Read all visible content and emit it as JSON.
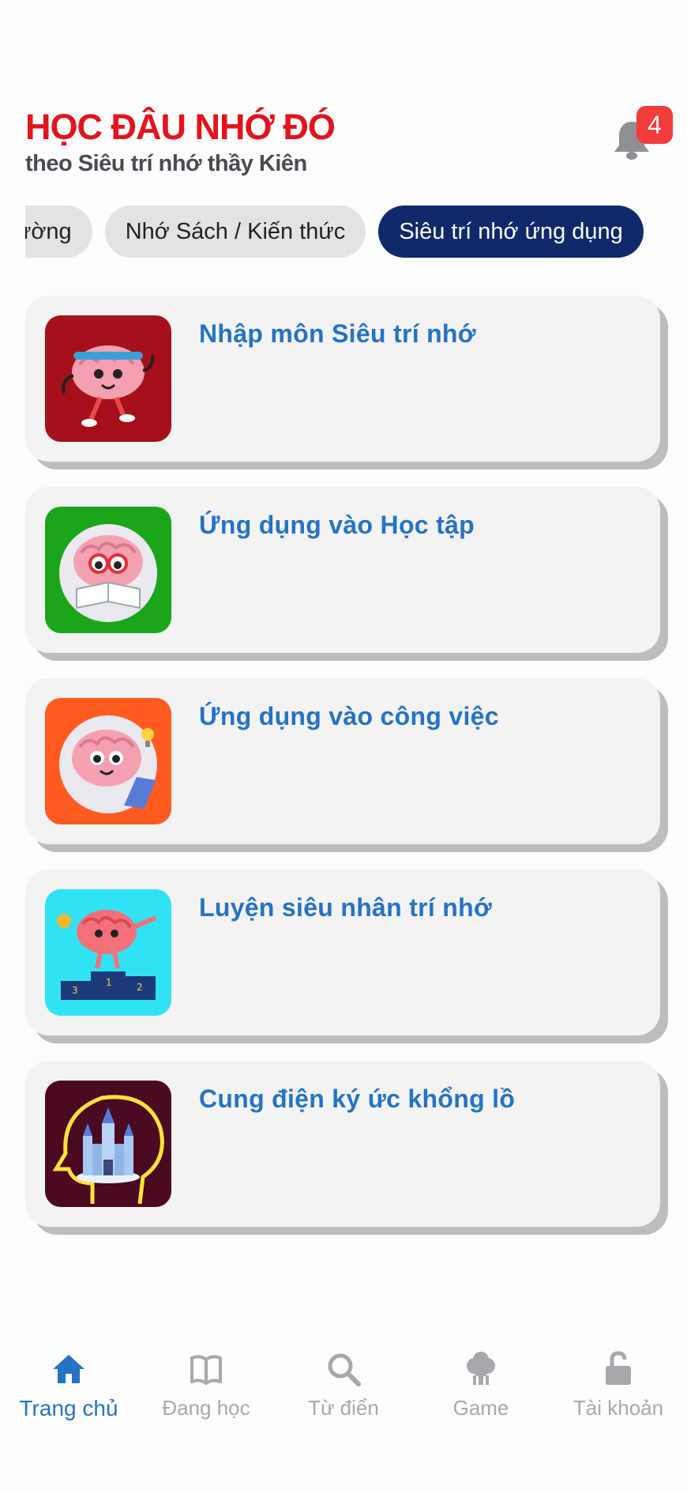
{
  "header": {
    "title": "HỌC ĐÂU NHỚ ĐÓ",
    "subtitle": "theo Siêu trí nhớ thầy Kiên",
    "notification_count": "4"
  },
  "chips": [
    {
      "label": "ường",
      "active": false
    },
    {
      "label": "Nhớ Sách / Kiến thức",
      "active": false
    },
    {
      "label": "Siêu trí nhớ ứng dụng",
      "active": true
    }
  ],
  "cards": [
    {
      "title": "Nhập môn Siêu trí nhớ",
      "icon": "brain-exercise-icon",
      "bg": "#a5101a"
    },
    {
      "title": "Ứng dụng vào Học tập",
      "icon": "brain-reading-icon",
      "bg": "#1aa51a"
    },
    {
      "title": "Ứng dụng vào công việc",
      "icon": "brain-laptop-icon",
      "bg": "#ff5a1f"
    },
    {
      "title": "Luyện siêu nhân trí nhớ",
      "icon": "brain-podium-icon",
      "bg": "#2fe3f5"
    },
    {
      "title": "Cung điện ký ức khổng lồ",
      "icon": "memory-palace-icon",
      "bg": "#4a0a22"
    }
  ],
  "tabs": [
    {
      "label": "Trang chủ",
      "icon": "home-icon",
      "active": true
    },
    {
      "label": "Đang học",
      "icon": "book-icon",
      "active": false
    },
    {
      "label": "Từ điển",
      "icon": "search-icon",
      "active": false
    },
    {
      "label": "Game",
      "icon": "tree-icon",
      "active": false
    },
    {
      "label": "Tài khoản",
      "icon": "unlock-icon",
      "active": false
    }
  ],
  "colors": {
    "title_red": "#e3131b",
    "accent_blue": "#2473c4",
    "chip_active": "#0e2a6b",
    "badge_red": "#f23b3b"
  }
}
